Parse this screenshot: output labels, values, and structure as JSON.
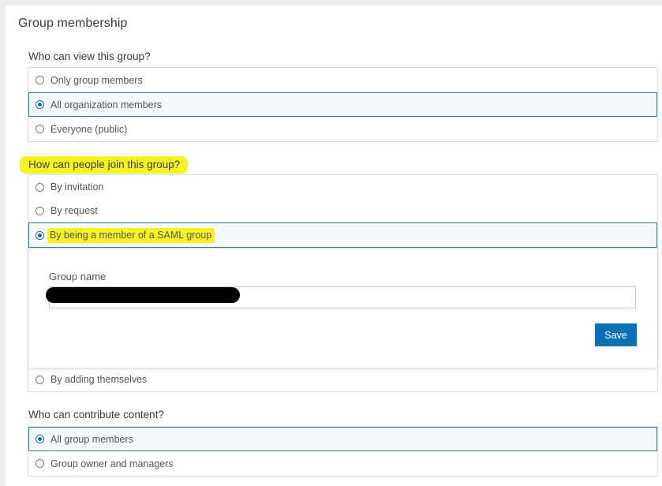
{
  "section_title": "Group membership",
  "view": {
    "question": "Who can view this group?",
    "options": [
      {
        "label": "Only group members",
        "selected": false
      },
      {
        "label": "All organization members",
        "selected": true
      },
      {
        "label": "Everyone (public)",
        "selected": false
      }
    ]
  },
  "join": {
    "question": "How can people join this group?",
    "options": [
      {
        "label": "By invitation",
        "selected": false
      },
      {
        "label": "By request",
        "selected": false
      },
      {
        "label": "By being a member of a SAML group",
        "selected": true
      },
      {
        "label": "By adding themselves",
        "selected": false
      }
    ],
    "saml": {
      "group_name_label": "Group name",
      "group_name_value": "",
      "save_label": "Save"
    }
  },
  "contribute": {
    "question": "Who can contribute content?",
    "options": [
      {
        "label": "All group members",
        "selected": true
      },
      {
        "label": "Group owner and managers",
        "selected": false
      }
    ]
  },
  "colors": {
    "accent": "#0a6fb4",
    "highlight": "#f7f31c",
    "selected_bg": "#f2f8fc",
    "selected_border": "#3d78a6"
  }
}
